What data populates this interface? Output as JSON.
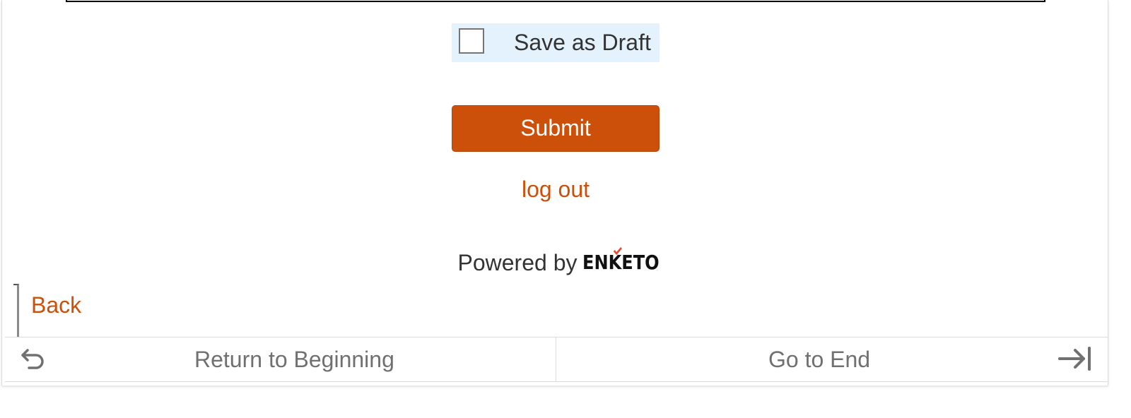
{
  "form": {
    "save_draft_label": "Save as Draft",
    "save_draft_checked": false,
    "submit_label": "Submit",
    "logout_label": "log out"
  },
  "footer": {
    "powered_by": "Powered by",
    "brand": "ENKETO"
  },
  "navigation": {
    "back_label": "Back",
    "first_label": "Return to Beginning",
    "last_label": "Go to End",
    "first_icon": "return-arrow-icon",
    "last_icon": "arrow-to-end-icon"
  },
  "colors": {
    "accent": "#cd500a",
    "draft_background": "#e3f2fd",
    "nav_text": "#707070"
  }
}
